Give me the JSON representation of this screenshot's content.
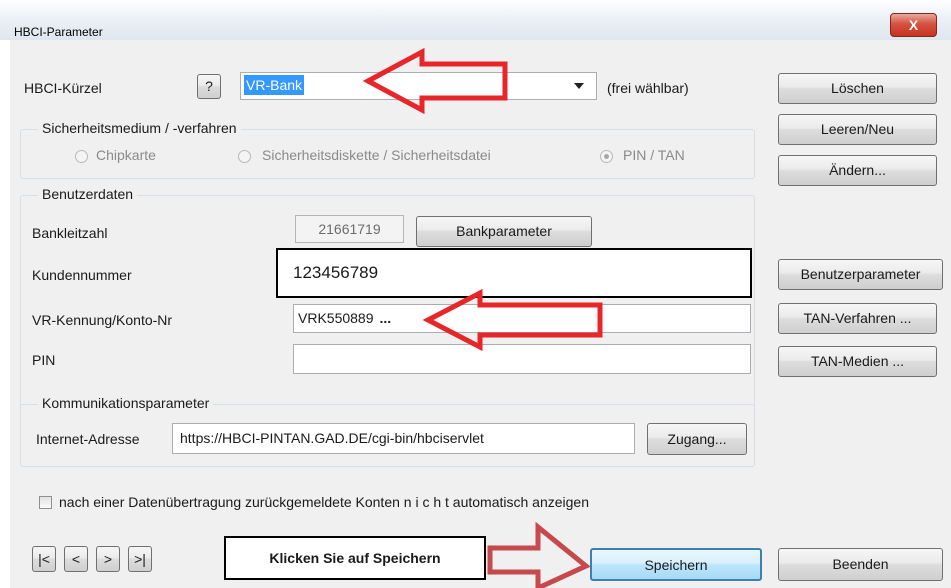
{
  "window": {
    "title": "HBCI-Parameter",
    "close_glyph": "X"
  },
  "kuerzel": {
    "label": "HBCI-Kürzel",
    "help_label": "?",
    "value": "VR-Bank",
    "note": "(frei wählbar)"
  },
  "sicherheit": {
    "legend": "Sicherheitsmedium / -verfahren",
    "options": [
      "Chipkarte",
      "Sicherheitsdiskette / Sicherheitsdatei",
      "PIN / TAN"
    ],
    "selected": "PIN / TAN"
  },
  "benutzer": {
    "legend": "Benutzerdaten",
    "blz_label": "Bankleitzahl",
    "blz_value": "21661719",
    "bankparameter_label": "Bankparameter",
    "kunden_label": "Kundennummer",
    "kunden_value": "123456789",
    "kennung_label": "VR-Kennung/Konto-Nr",
    "kennung_value": "VRK550889",
    "kennung_ellipsis": "...",
    "pin_label": "PIN",
    "pin_value": ""
  },
  "kommunikation": {
    "legend": "Kommunikationsparameter",
    "url_label": "Internet-Adresse",
    "url_value": "https://HBCI-PINTAN.GAD.DE/cgi-bin/hbciservlet",
    "zugang_label": "Zugang..."
  },
  "checkbox": {
    "label": "nach einer Datenübertragung zurückgemeldete Konten  n i c h t  automatisch anzeigen",
    "checked": false
  },
  "side_buttons": {
    "loeschen": "Löschen",
    "leeren": "Leeren/Neu",
    "aendern": "Ändern...",
    "benutzerparameter": "Benutzerparameter",
    "tan_verfahren": "TAN-Verfahren ...",
    "tan_medien": "TAN-Medien ..."
  },
  "nav": {
    "first": "|<",
    "prev": "<",
    "next": ">",
    "last": ">|"
  },
  "callout": {
    "text": "Klicken Sie auf Speichern"
  },
  "bottom_buttons": {
    "speichern": "Speichern",
    "beenden": "Beenden"
  },
  "colors": {
    "annotation_red": "#e8262a",
    "selection_blue": "#3399ff",
    "dialog_bg": "#f0f0f0"
  }
}
